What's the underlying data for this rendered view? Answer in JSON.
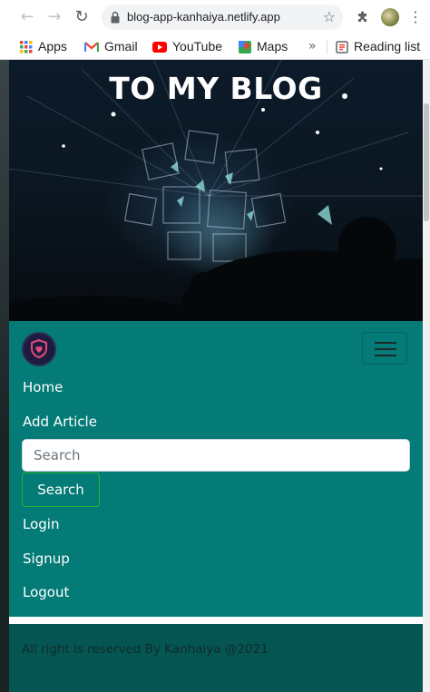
{
  "browser": {
    "url": "blog-app-kanhaiya.netlify.app",
    "icons": {
      "back": "arrow-left-icon",
      "forward": "arrow-right-icon",
      "reload": "reload-icon",
      "lock": "lock-icon",
      "star": "star-icon",
      "extensions": "puzzle-icon",
      "menu": "kebab-menu-icon"
    },
    "bookmarks": [
      {
        "label": "Apps",
        "icon": "apps-grid-icon"
      },
      {
        "label": "Gmail",
        "icon": "gmail-icon"
      },
      {
        "label": "YouTube",
        "icon": "youtube-icon"
      },
      {
        "label": "Maps",
        "icon": "maps-icon"
      }
    ],
    "more_bookmarks": "»",
    "reading_list": "Reading list"
  },
  "hero": {
    "title": "TO MY BLOG"
  },
  "navbar": {
    "links": {
      "home": "Home",
      "add_article": "Add Article",
      "login": "Login",
      "signup": "Signup",
      "logout": "Logout"
    },
    "search": {
      "placeholder": "Search",
      "button": "Search"
    },
    "colors": {
      "navbar_bg": "#047b76",
      "footer_bg": "#055653",
      "search_button_border": "#27b23a"
    }
  },
  "footer": {
    "text": "All right is reserved By Kanhaiya @2021"
  }
}
